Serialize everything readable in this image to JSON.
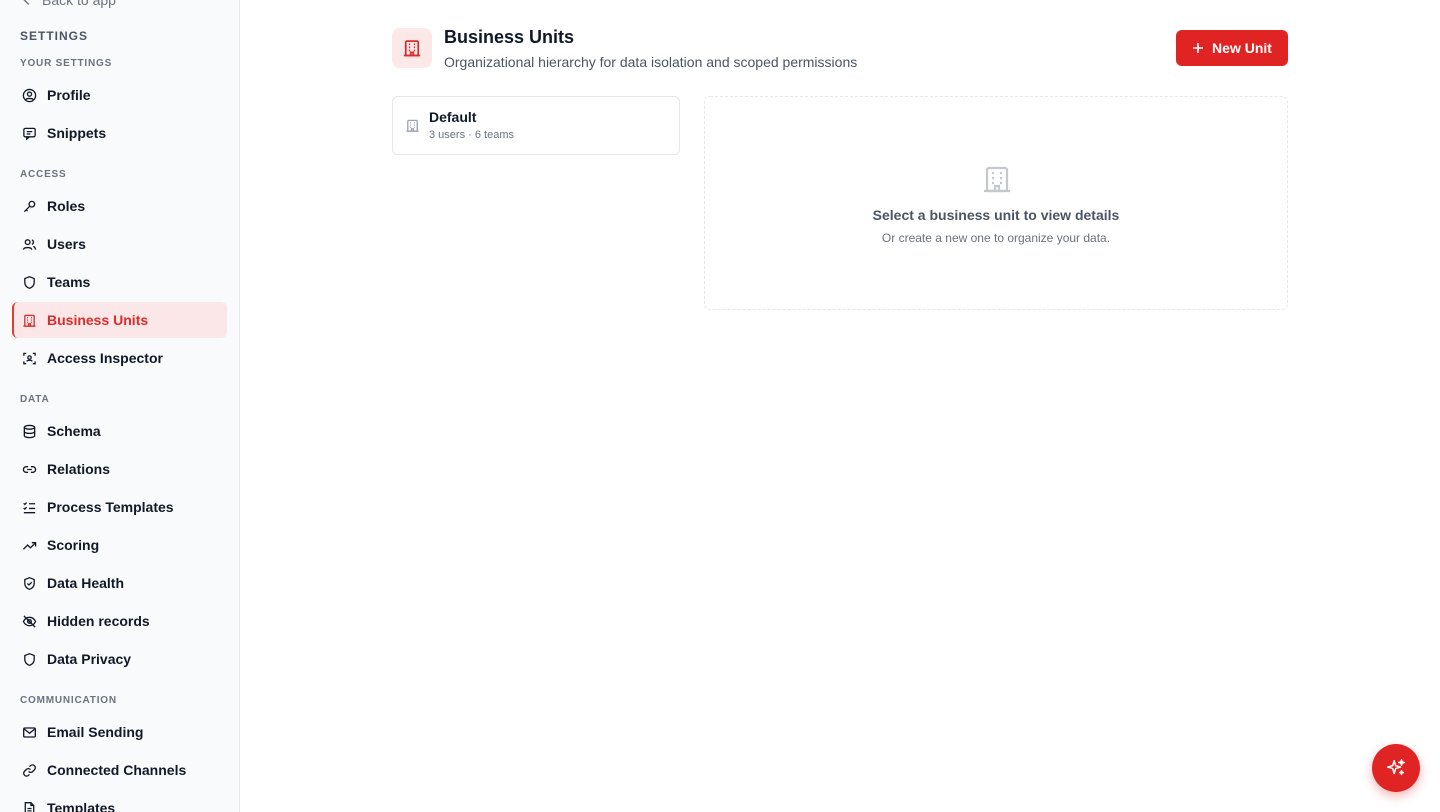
{
  "sidebar": {
    "back_label": "Back to app",
    "title": "SETTINGS",
    "sections": {
      "your_settings": "YOUR SETTINGS",
      "access": "ACCESS",
      "data": "DATA",
      "communication": "COMMUNICATION"
    },
    "items": {
      "profile": "Profile",
      "snippets": "Snippets",
      "roles": "Roles",
      "users": "Users",
      "teams": "Teams",
      "business_units": "Business Units",
      "access_inspector": "Access Inspector",
      "schema": "Schema",
      "relations": "Relations",
      "process_templates": "Process Templates",
      "scoring": "Scoring",
      "data_health": "Data Health",
      "hidden_records": "Hidden records",
      "data_privacy": "Data Privacy",
      "email_sending": "Email Sending",
      "connected_channels": "Connected Channels",
      "templates": "Templates"
    },
    "active_item": "business_units"
  },
  "header": {
    "title": "Business Units",
    "subtitle": "Organizational hierarchy for data isolation and scoped permissions",
    "new_button_label": "New Unit"
  },
  "units": [
    {
      "name": "Default",
      "meta": "3 users · 6 teams"
    }
  ],
  "detail": {
    "empty_title": "Select a business unit to view details",
    "empty_subtitle": "Or create a new one to organize your data."
  },
  "colors": {
    "accent": "#e02424",
    "active_bg": "#fbe7e7"
  }
}
